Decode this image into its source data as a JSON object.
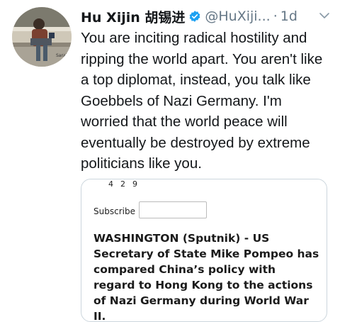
{
  "tweet": {
    "author_name": "Hu Xijin 胡锡进",
    "handle": "@HuXiji...",
    "separator": "·",
    "timestamp": "1d",
    "text": "You are inciting radical hostility and ripping the world apart. You aren't like a top diplomat, instead, you talk like Goebbels of Nazi Germany. I'm worried that the world peace will eventually be destroyed by extreme politicians like you.",
    "icons": {
      "verified": "verified-badge-icon",
      "menu": "chevron-down-icon"
    }
  },
  "avatar": {
    "caption": "Sarajo"
  },
  "card": {
    "counts": "4  2  9",
    "subscribe_label": "Subscribe",
    "subscribe_value": "",
    "article_text": "WASHINGTON (Sputnik) - US Secretary of State Mike Pompeo has compared China’s policy with regard to Hong Kong to the actions of Nazi Germany during World War II."
  },
  "colors": {
    "text": "#14171a",
    "muted": "#657786",
    "verified_blue": "#1da1f2",
    "card_border": "#ccd6dd"
  }
}
